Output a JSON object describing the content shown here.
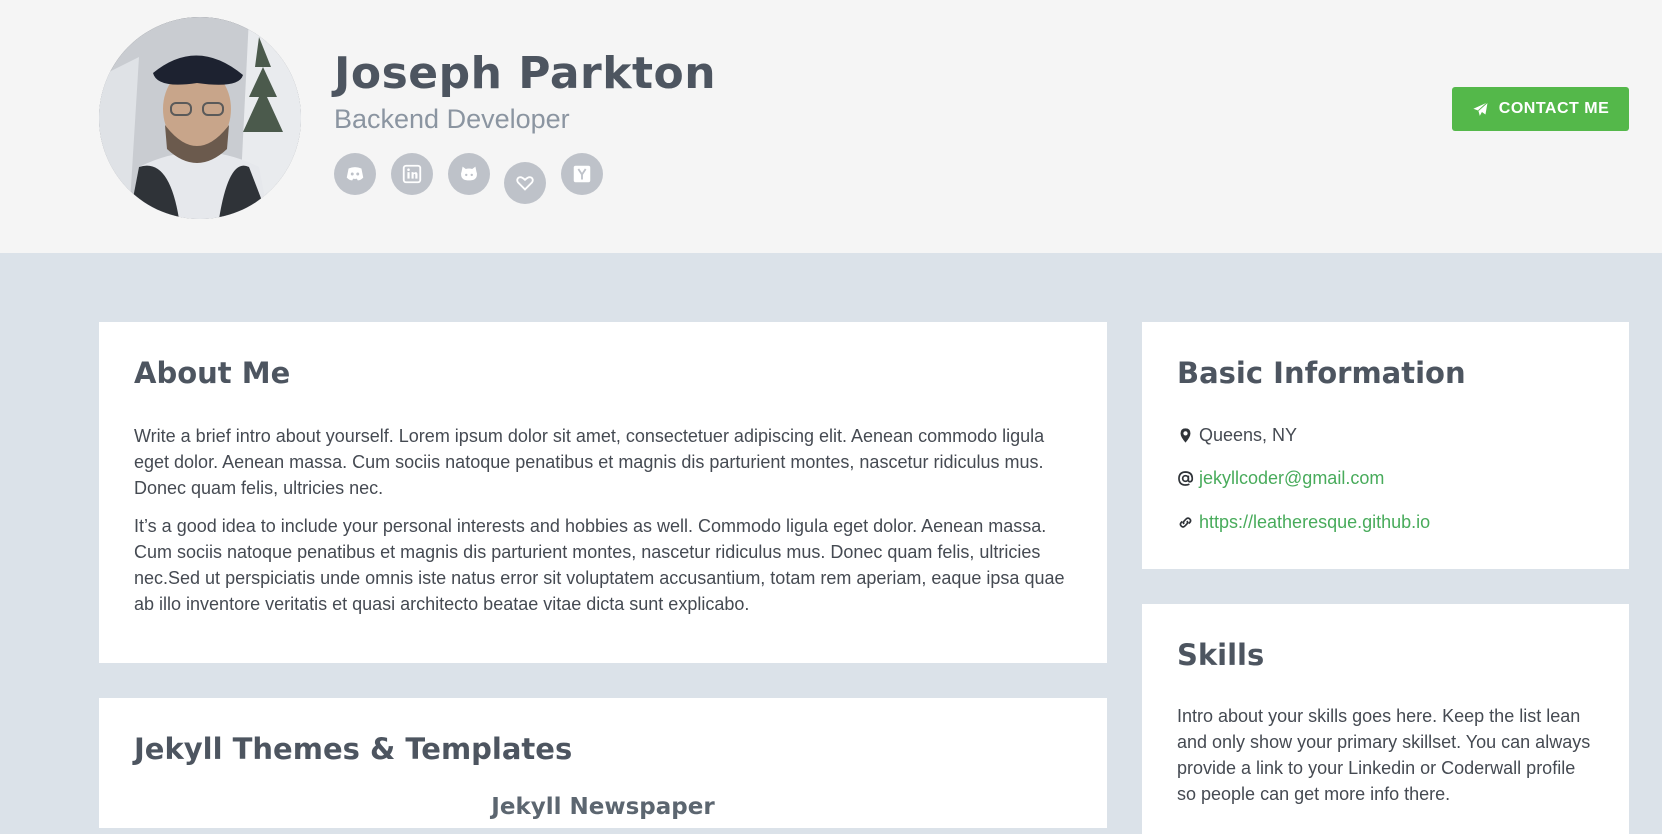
{
  "profile": {
    "name": "Joseph Parkton",
    "role": "Backend Developer"
  },
  "social_icons": [
    "discord-icon",
    "linkedin-icon",
    "github-icon",
    "heart-icon",
    "hacker-news-icon"
  ],
  "contact_button": {
    "label": "CONTACT ME",
    "icon": "paper-plane-icon"
  },
  "colors": {
    "accent_green": "#54b84a",
    "link_green": "#48ab5b",
    "page_background": "#dbe2e9",
    "header_background": "#f5f5f5",
    "heading_text": "#4d5560"
  },
  "about": {
    "title": "About Me",
    "paragraph1": "Write a brief intro about yourself. Lorem ipsum dolor sit amet, consectetuer adipiscing elit. Aenean commodo ligula eget dolor. Aenean massa. Cum sociis natoque penatibus et magnis dis parturient montes, nascetur ridiculus mus. Donec quam felis, ultricies nec.",
    "paragraph2": "It’s a good idea to include your personal interests and hobbies as well. Commodo ligula eget dolor. Aenean massa. Cum sociis natoque penatibus et magnis dis parturient montes, nascetur ridiculus mus. Donec quam felis, ultricies nec.Sed ut perspiciatis unde omnis iste natus error sit voluptatem accusantium, totam rem aperiam, eaque ipsa quae ab illo inventore veritatis et quasi architecto beatae vitae dicta sunt explicabo."
  },
  "themes": {
    "title": "Jekyll Themes & Templates",
    "first_item": "Jekyll Newspaper"
  },
  "basic_info": {
    "title": "Basic Information",
    "location": "Queens, NY",
    "email": "jekyllcoder@gmail.com",
    "website": "https://leatheresque.github.io"
  },
  "skills": {
    "title": "Skills",
    "intro": "Intro about your skills goes here. Keep the list lean and only show your primary skillset. You can always provide a link to your Linkedin or Coderwall profile so people can get more info there."
  }
}
